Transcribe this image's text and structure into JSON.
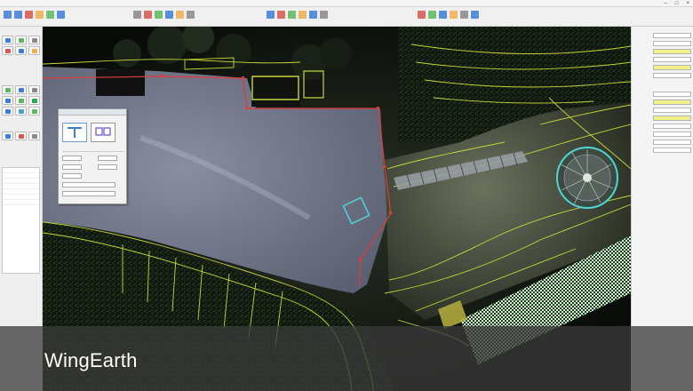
{
  "window": {
    "title": "",
    "controls": [
      "–",
      "□",
      "×"
    ]
  },
  "toolbar": {
    "icon_colors": [
      "#3b7dd8",
      "#3b7dd8",
      "#d9534f",
      "#f0ad4e",
      "#5cb85c",
      "#3b7dd8",
      "#888888",
      "#d9534f",
      "#5cb85c",
      "#3b7dd8",
      "#f0ad4e",
      "#888888",
      "#3b7dd8",
      "#d9534f",
      "#5cb85c",
      "#f0ad4e",
      "#3b7dd8",
      "#888888",
      "#d9534f",
      "#5cb85c",
      "#3b7dd8",
      "#f0ad4e",
      "#888888",
      "#3b7dd8"
    ]
  },
  "viewport": {
    "background": "#0a0d0a",
    "paved_area_color": "#6f7486",
    "boundary_color": "#e23b3b",
    "contour_color": "#c7d63a",
    "selection_color": "#4fd6d6",
    "hatch_color": "#d8f0d8"
  },
  "caption": {
    "product_name": "WingEarth"
  }
}
